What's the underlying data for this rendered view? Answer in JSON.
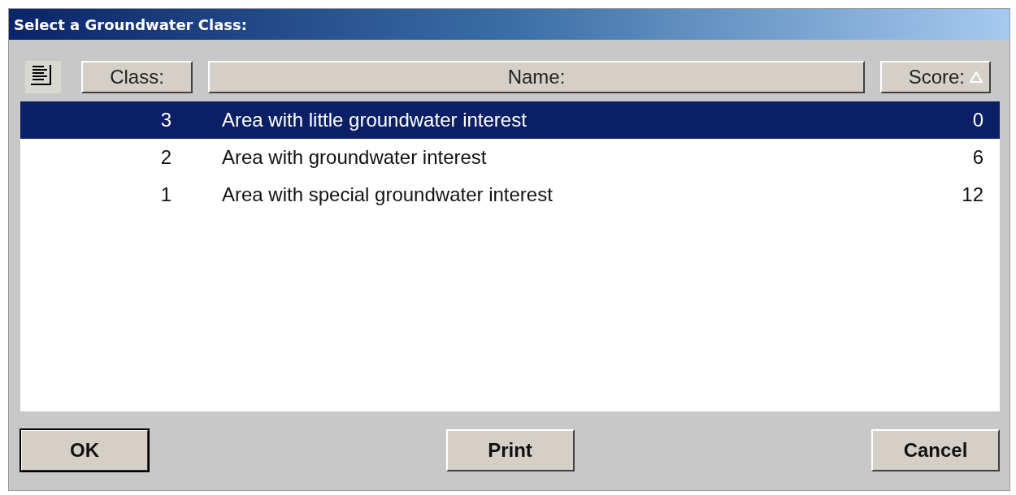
{
  "window": {
    "title": "Select a Groundwater Class:"
  },
  "table": {
    "columns": [
      {
        "label": "Class:",
        "sorted": false
      },
      {
        "label": "Name:",
        "sorted": false
      },
      {
        "label": "Score:",
        "sorted": true
      }
    ],
    "rows": [
      {
        "class": "3",
        "name": "Area with little groundwater interest",
        "score": "0",
        "selected": true
      },
      {
        "class": "2",
        "name": "Area with groundwater interest",
        "score": "6",
        "selected": false
      },
      {
        "class": "1",
        "name": "Area with special groundwater interest",
        "score": "12",
        "selected": false
      }
    ]
  },
  "buttons": [
    {
      "label": "OK",
      "default": true
    },
    {
      "label": "Print",
      "default": false
    },
    {
      "label": "Cancel",
      "default": false
    }
  ]
}
